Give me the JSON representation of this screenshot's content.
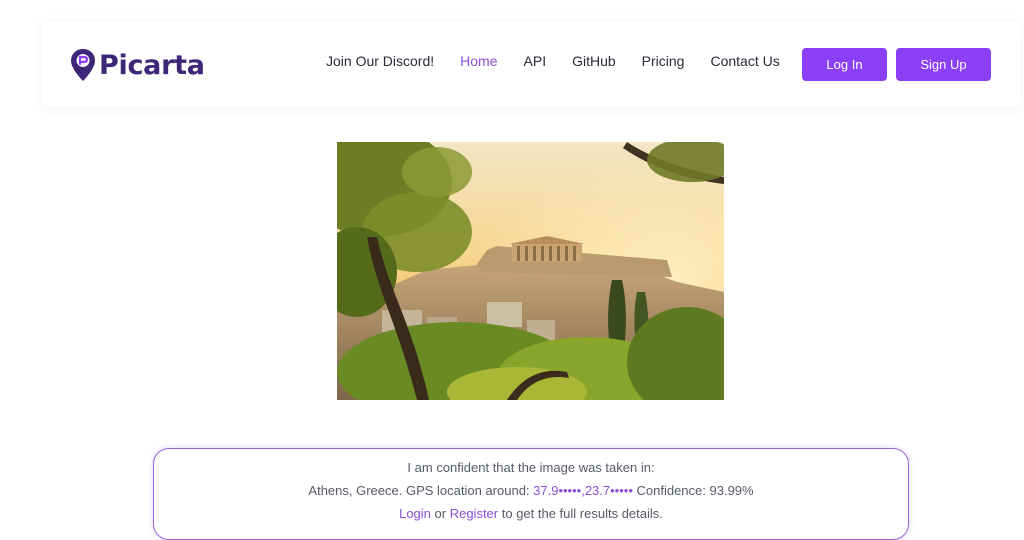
{
  "brand": {
    "name": "Picarta",
    "logo_color": "#3d2577",
    "accent_color": "#8b3ff6"
  },
  "nav": {
    "links": [
      {
        "label": "Join Our Discord!"
      },
      {
        "label": "Home",
        "active": true
      },
      {
        "label": "API"
      },
      {
        "label": "GitHub"
      },
      {
        "label": "Pricing"
      },
      {
        "label": "Contact Us"
      }
    ],
    "login_label": "Log In",
    "signup_label": "Sign Up"
  },
  "result": {
    "intro": "I am confident that the image was taken in:",
    "location_prefix": "Athens, Greece. GPS location around: ",
    "gps": "37.9•••••,23.7•••••",
    "confidence": " Confidence: 93.99%",
    "login_link": "Login",
    "or_text": " or ",
    "register_link": "Register",
    "details_text": " to get the full results details."
  }
}
